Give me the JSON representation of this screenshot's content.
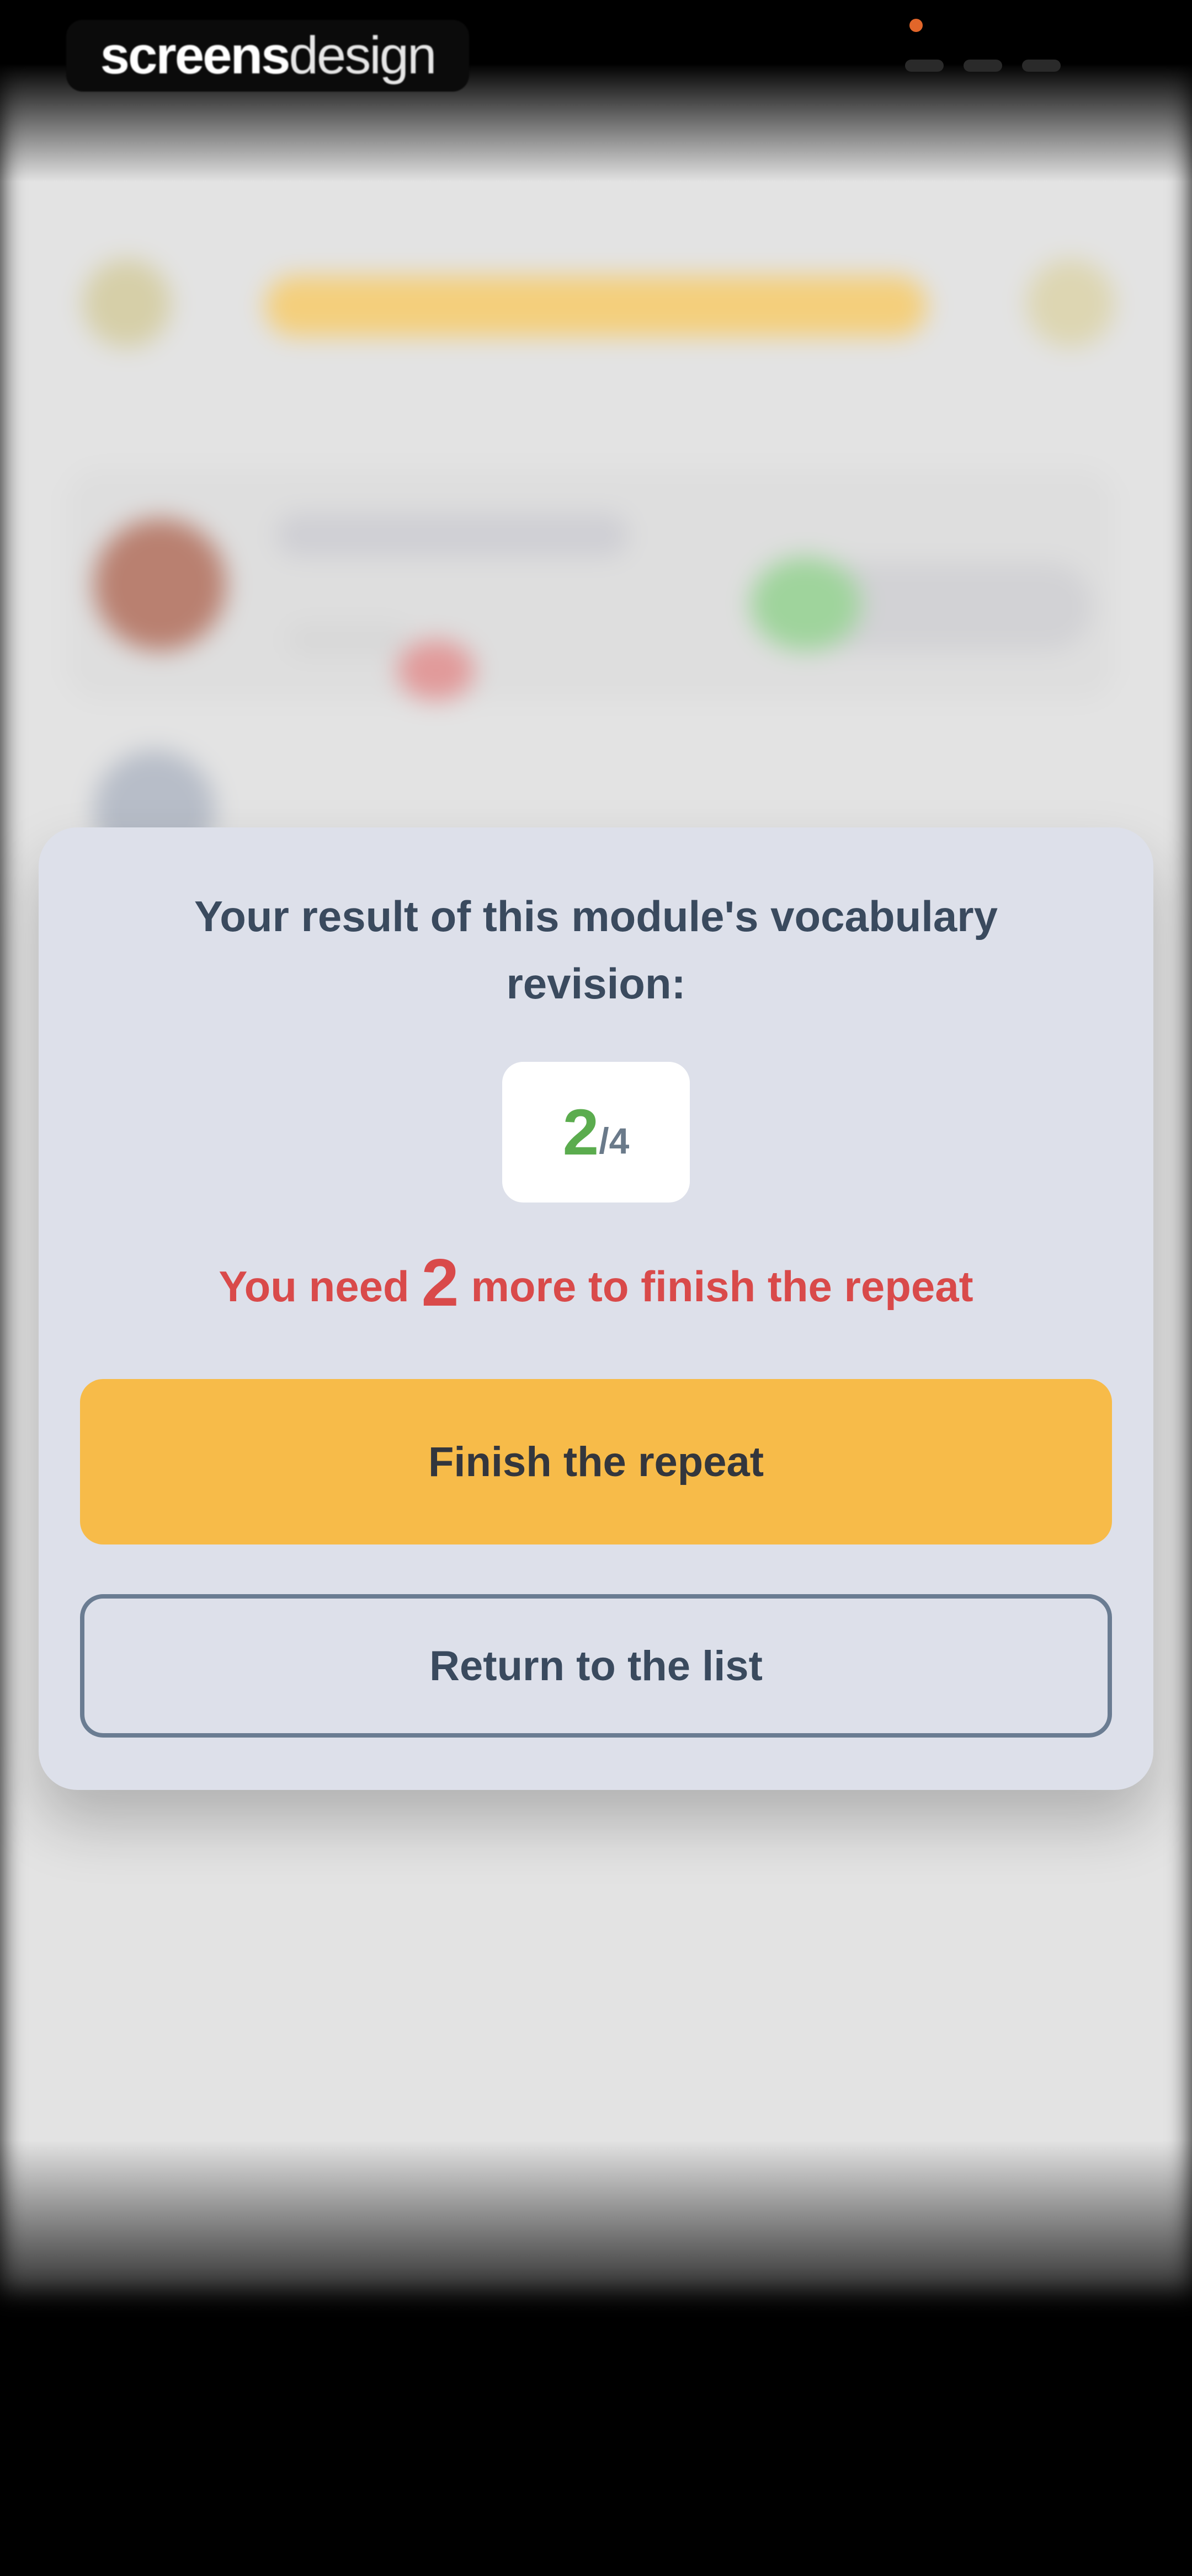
{
  "status_bar": {
    "brand_bold": "screens",
    "brand_light": "design"
  },
  "dialog": {
    "title": "Your result of this module's vocabulary revision:",
    "score": {
      "correct": "2",
      "separator": "/",
      "total": "4"
    },
    "need_prefix": "You need",
    "need_count": "2",
    "need_suffix": "more to finish the repeat",
    "primary_button": "Finish the repeat",
    "secondary_button": "Return to the list"
  },
  "colors": {
    "accent": "#f7bb49",
    "success": "#5bac4e",
    "warning": "#d94a4a",
    "dialog_bg": "#dde0ea",
    "text": "#3a4a5e"
  }
}
